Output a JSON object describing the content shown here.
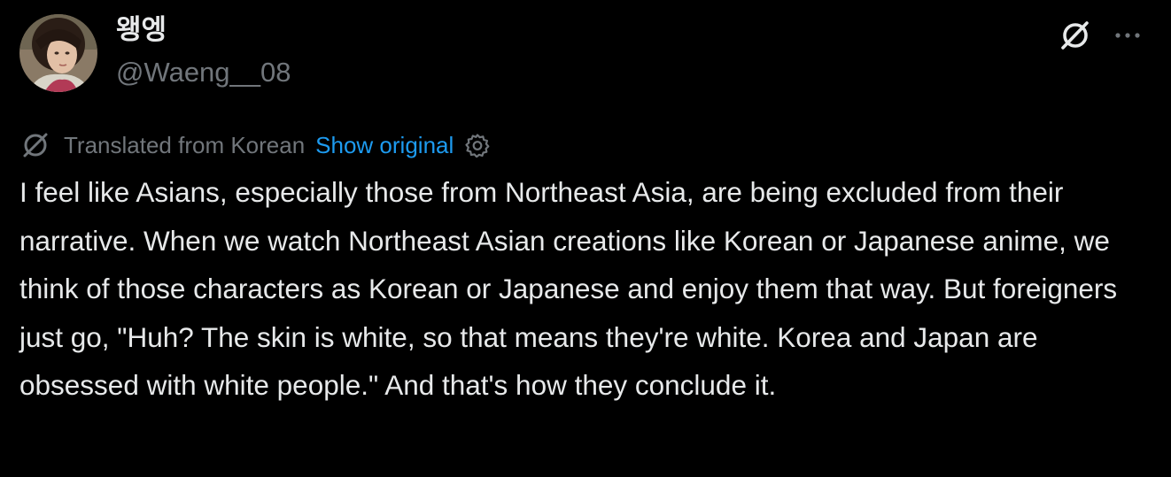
{
  "author": {
    "display_name": "왱엥",
    "handle": "@Waeng__08",
    "avatar_icon": "profile-photo"
  },
  "actions": {
    "grok_icon": "grok-slash-icon",
    "more_icon": "more-horizontal-icon"
  },
  "translation": {
    "label": "Translated from Korean",
    "show_original_label": "Show original",
    "settings_icon": "gear-icon"
  },
  "tweet": {
    "text": "I feel like Asians, especially those from Northeast Asia, are being excluded from their narrative. When we watch Northeast Asian creations like Korean or Japanese anime, we think of those characters as Korean or Japanese and enjoy them that way. But foreigners just go, \"Huh? The skin is white, so that means they're white. Korea and Japan are obsessed with white people.\" And that's how they conclude it."
  },
  "colors": {
    "background": "#000000",
    "primary_text": "#e7e9ea",
    "secondary_text": "#71767b",
    "link": "#1d9bf0"
  }
}
